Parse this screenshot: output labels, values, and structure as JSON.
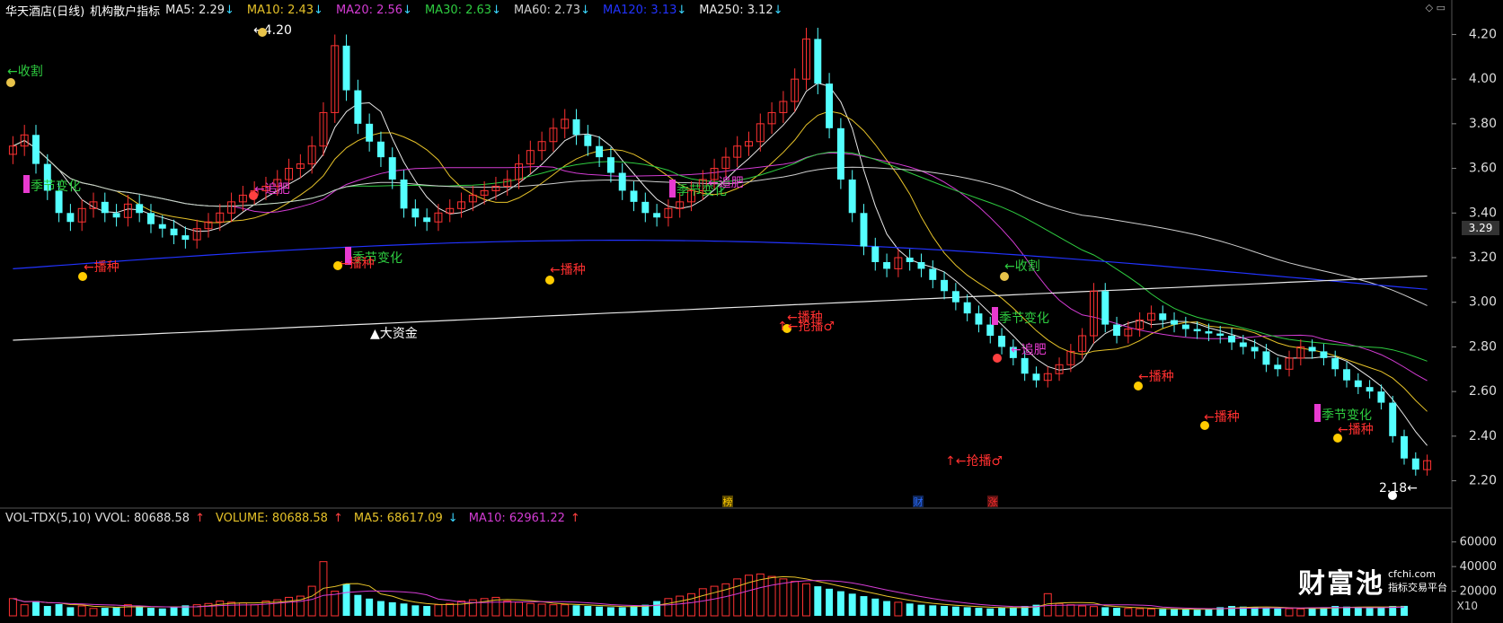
{
  "header": {
    "title": "华天酒店(日线)",
    "indicator_name": "机构散户指标",
    "ma": [
      {
        "label": "MA5: 2.29",
        "color": "#e8e8e8",
        "arrow": "↓"
      },
      {
        "label": "MA10: 2.43",
        "color": "#e6c229",
        "arrow": "↓"
      },
      {
        "label": "MA20: 2.56",
        "color": "#d43cd4",
        "arrow": "↓"
      },
      {
        "label": "MA30: 2.63",
        "color": "#2ecc40",
        "arrow": "↓"
      },
      {
        "label": "MA60: 2.73",
        "color": "#cfcfcf",
        "arrow": "↓"
      },
      {
        "label": "MA120: 3.13",
        "color": "#2233ff",
        "arrow": "↓"
      },
      {
        "label": "MA250: 3.12",
        "color": "#e8e8e8",
        "arrow": "↓"
      }
    ]
  },
  "volume_header": {
    "label1": "VOL-TDX(5,10) VVOL: 80688.58",
    "arrow1": "↑",
    "label2": "VOLUME: 80688.58",
    "arrow2": "↑",
    "label3": "MA5: 68617.09",
    "arrow3": "↓",
    "label4": "MA10: 62961.22",
    "arrow4": "↑"
  },
  "price_axis": [
    "4.20",
    "4.00",
    "3.80",
    "3.60",
    "3.40",
    "3.20",
    "3.00",
    "2.80",
    "2.60",
    "2.40",
    "2.20"
  ],
  "current_price": "3.29",
  "volume_axis": [
    "60000",
    "40000",
    "20000"
  ],
  "volume_unit": "X10",
  "labels": {
    "high_price": "4.20",
    "low_price": "2.18",
    "big_money": "▲大资金",
    "harvest": "收割",
    "season": "季节变化",
    "fertilize": "追肥",
    "sow": "播种",
    "grab": "抢播♂"
  },
  "event_markers": [
    "榜",
    "财",
    "涨"
  ],
  "logo": {
    "name": "财富池",
    "site": "cfchi.com",
    "tagline": "指标交易平台"
  },
  "colors": {
    "up": "#ff3232",
    "down": "#54ffff",
    "ma5": "#e8e8e8",
    "ma10": "#e6c229",
    "ma20": "#d43cd4",
    "ma30": "#2ecc40",
    "ma60": "#cfcfcf",
    "ma120": "#2233ff",
    "ma250": "#e8e8e8"
  },
  "chart_data": {
    "type": "candlestick",
    "ylim": [
      2.15,
      4.25
    ],
    "closes": [
      3.7,
      3.75,
      3.62,
      3.5,
      3.4,
      3.36,
      3.42,
      3.45,
      3.4,
      3.38,
      3.44,
      3.4,
      3.35,
      3.33,
      3.3,
      3.28,
      3.33,
      3.36,
      3.4,
      3.45,
      3.48,
      3.5,
      3.52,
      3.55,
      3.6,
      3.62,
      3.7,
      3.85,
      4.15,
      3.95,
      3.8,
      3.72,
      3.65,
      3.55,
      3.42,
      3.38,
      3.36,
      3.4,
      3.42,
      3.45,
      3.48,
      3.5,
      3.52,
      3.55,
      3.62,
      3.68,
      3.72,
      3.78,
      3.82,
      3.75,
      3.7,
      3.65,
      3.58,
      3.5,
      3.45,
      3.4,
      3.38,
      3.42,
      3.45,
      3.5,
      3.55,
      3.6,
      3.65,
      3.7,
      3.72,
      3.8,
      3.85,
      3.9,
      4.0,
      4.18,
      3.98,
      3.78,
      3.55,
      3.4,
      3.25,
      3.18,
      3.15,
      3.2,
      3.18,
      3.15,
      3.1,
      3.05,
      3.0,
      2.95,
      2.9,
      2.85,
      2.8,
      2.75,
      2.68,
      2.65,
      2.68,
      2.72,
      2.78,
      2.85,
      3.05,
      2.9,
      2.85,
      2.88,
      2.92,
      2.95,
      2.92,
      2.9,
      2.88,
      2.87,
      2.86,
      2.85,
      2.82,
      2.8,
      2.78,
      2.72,
      2.7,
      2.75,
      2.8,
      2.78,
      2.75,
      2.7,
      2.65,
      2.62,
      2.6,
      2.55,
      2.4,
      2.3,
      2.25,
      2.29
    ],
    "volume": [
      14000,
      9000,
      12000,
      8000,
      9500,
      7000,
      8000,
      6000,
      6500,
      7000,
      9000,
      8000,
      6500,
      6000,
      7000,
      8500,
      9000,
      10000,
      12000,
      11000,
      10500,
      9000,
      12000,
      13000,
      15000,
      16000,
      24000,
      44000,
      20000,
      26000,
      17000,
      14000,
      12000,
      11000,
      10000,
      8500,
      8000,
      9000,
      10000,
      12000,
      13000,
      14000,
      15000,
      12000,
      11000,
      10000,
      9500,
      9000,
      9000,
      8500,
      8000,
      7500,
      7000,
      7000,
      8000,
      9000,
      12000,
      14000,
      16000,
      18000,
      22000,
      24000,
      26000,
      30000,
      33000,
      34000,
      32000,
      30000,
      28000,
      26000,
      24000,
      22000,
      20000,
      18000,
      16000,
      14000,
      12000,
      11000,
      10000,
      9000,
      8500,
      8000,
      7500,
      7000,
      6500,
      6000,
      6500,
      7000,
      8000,
      9000,
      18000,
      10000,
      9000,
      8000,
      7500,
      7000,
      6500,
      6000,
      5800,
      5600,
      5500,
      5400,
      5200,
      5000,
      6000,
      7000,
      8000,
      7500,
      7000,
      6500,
      6000,
      5800,
      5600,
      6000,
      7000,
      8000,
      7500,
      7000,
      6500,
      7000,
      8000,
      8069
    ]
  }
}
